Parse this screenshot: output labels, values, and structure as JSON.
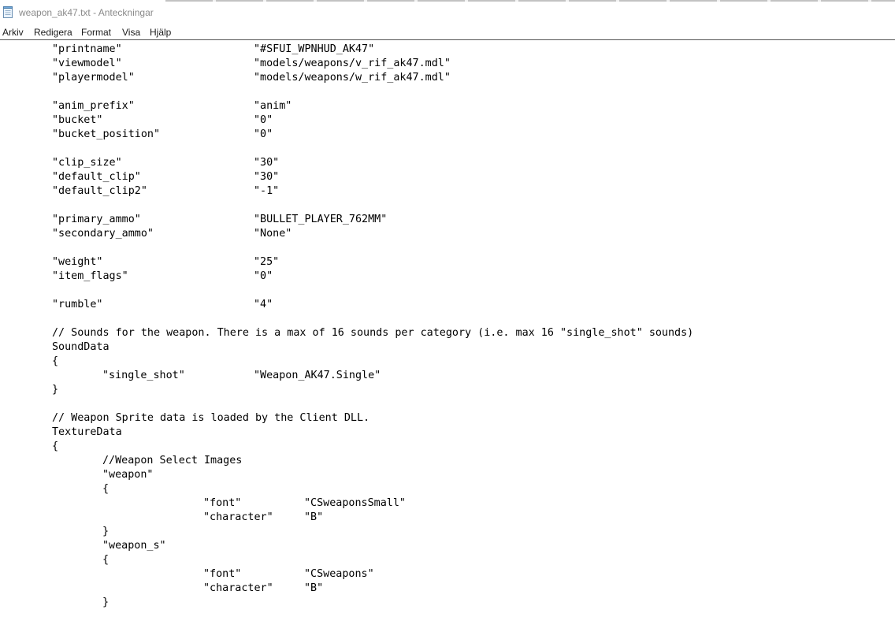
{
  "window": {
    "title": "weapon_ak47.txt - Anteckningar"
  },
  "menu": {
    "items": [
      "Arkiv",
      "Redigera",
      "Format",
      "Visa",
      "Hjälp"
    ]
  },
  "icons": {
    "app": "notepad-icon"
  },
  "document": {
    "lines": [
      {
        "indent": 1,
        "key": "\"printname\"",
        "value": "\"#SFUI_WPNHUD_AK47\""
      },
      {
        "indent": 1,
        "key": "\"viewmodel\"",
        "value": "\"models/weapons/v_rif_ak47.mdl\""
      },
      {
        "indent": 1,
        "key": "\"playermodel\"",
        "value": "\"models/weapons/w_rif_ak47.mdl\""
      },
      {
        "blank": true
      },
      {
        "indent": 1,
        "key": "\"anim_prefix\"",
        "value": "\"anim\""
      },
      {
        "indent": 1,
        "key": "\"bucket\"",
        "value": "\"0\""
      },
      {
        "indent": 1,
        "key": "\"bucket_position\"",
        "value": "\"0\""
      },
      {
        "blank": true
      },
      {
        "indent": 1,
        "key": "\"clip_size\"",
        "value": "\"30\""
      },
      {
        "indent": 1,
        "key": "\"default_clip\"",
        "value": "\"30\""
      },
      {
        "indent": 1,
        "key": "\"default_clip2\"",
        "value": "\"-1\""
      },
      {
        "blank": true
      },
      {
        "indent": 1,
        "key": "\"primary_ammo\"",
        "value": "\"BULLET_PLAYER_762MM\""
      },
      {
        "indent": 1,
        "key": "\"secondary_ammo\"",
        "value": "\"None\""
      },
      {
        "blank": true
      },
      {
        "indent": 1,
        "key": "\"weight\"",
        "value": "\"25\""
      },
      {
        "indent": 1,
        "key": "\"item_flags\"",
        "value": "\"0\""
      },
      {
        "blank": true
      },
      {
        "indent": 1,
        "key": "\"rumble\"",
        "value": "\"4\""
      },
      {
        "blank": true
      },
      {
        "indent": 1,
        "key": "// Sounds for the weapon. There is a max of 16 sounds per category (i.e. max 16 \"single_shot\" sounds)"
      },
      {
        "indent": 1,
        "key": "SoundData"
      },
      {
        "indent": 1,
        "key": "{"
      },
      {
        "indent": 2,
        "key": "\"single_shot\"",
        "value": "\"Weapon_AK47.Single\""
      },
      {
        "indent": 1,
        "key": "}"
      },
      {
        "blank": true
      },
      {
        "indent": 1,
        "key": "// Weapon Sprite data is loaded by the Client DLL."
      },
      {
        "indent": 1,
        "key": "TextureData"
      },
      {
        "indent": 1,
        "key": "{"
      },
      {
        "indent": 2,
        "key": "//Weapon Select Images"
      },
      {
        "indent": 2,
        "key": "\"weapon\""
      },
      {
        "indent": 2,
        "key": "{"
      },
      {
        "indent": 4,
        "key": "\"font\"",
        "value": "\"CSweaponsSmall\""
      },
      {
        "indent": 4,
        "key": "\"character\"",
        "value": "\"B\""
      },
      {
        "indent": 2,
        "key": "}"
      },
      {
        "indent": 2,
        "key": "\"weapon_s\""
      },
      {
        "indent": 2,
        "key": "{"
      },
      {
        "indent": 4,
        "key": "\"font\"",
        "value": "\"CSweapons\""
      },
      {
        "indent": 4,
        "key": "\"character\"",
        "value": "\"B\""
      },
      {
        "indent": 2,
        "key": "}"
      }
    ]
  }
}
